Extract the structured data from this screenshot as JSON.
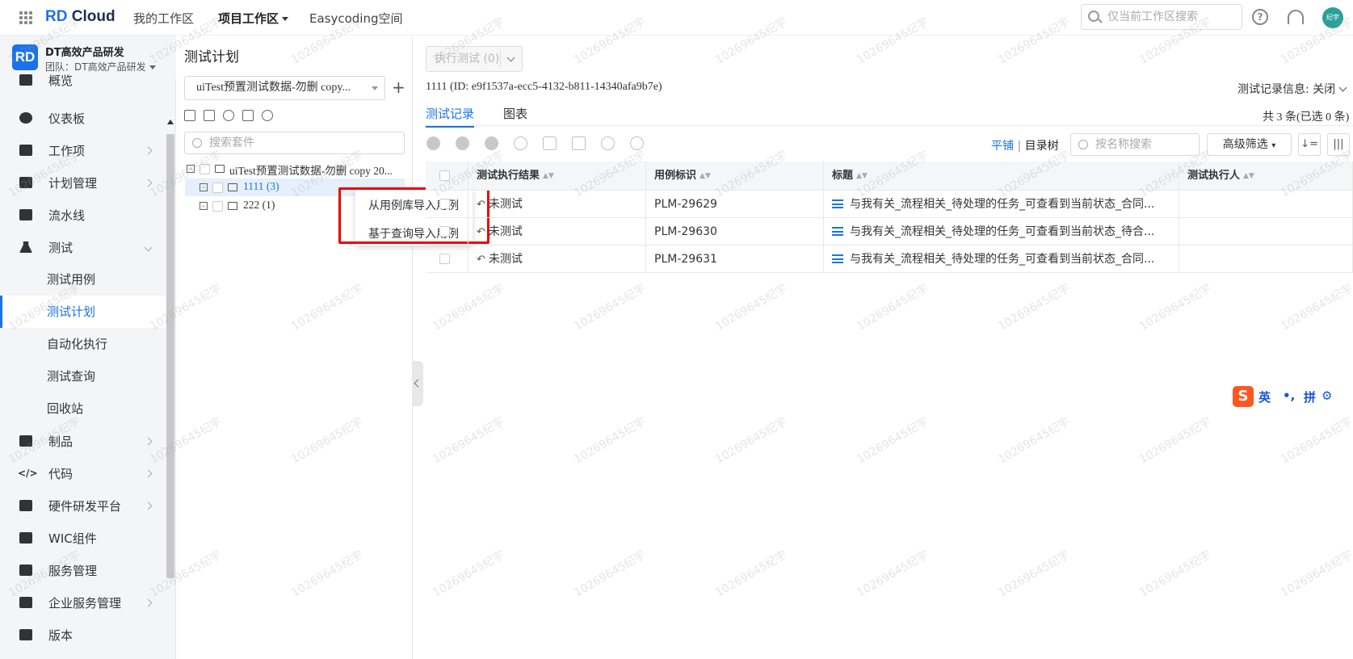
{
  "topbar": {
    "logo_rd": "RD",
    "logo_cloud": "Cloud",
    "nav": [
      "我的工作区",
      "项目工作区",
      "Easycoding空间"
    ],
    "search_placeholder": "仅当前工作区搜索",
    "avatar": "纪宇"
  },
  "sidebar": {
    "logo": "RD",
    "title": "DT高效产品研发",
    "team": "团队：DT高效产品研发",
    "items": [
      {
        "label": "概览",
        "icon": "overview-icon"
      },
      {
        "label": "仪表板",
        "icon": "dashboard-icon"
      },
      {
        "label": "工作项",
        "icon": "workitem-icon"
      },
      {
        "label": "计划管理",
        "icon": "plan-icon"
      },
      {
        "label": "流水线",
        "icon": "pipeline-icon"
      },
      {
        "label": "测试",
        "icon": "flask-icon"
      },
      {
        "label": "制品",
        "icon": "artifact-icon"
      },
      {
        "label": "代码",
        "icon": "code-icon"
      },
      {
        "label": "硬件研发平台",
        "icon": "hardware-icon"
      },
      {
        "label": "WIC组件",
        "icon": "wic-icon"
      },
      {
        "label": "服务管理",
        "icon": "service-icon"
      },
      {
        "label": "企业服务管理",
        "icon": "enterprise-icon"
      },
      {
        "label": "版本",
        "icon": "version-icon"
      }
    ],
    "sub": [
      "测试用例",
      "测试计划",
      "自动化执行",
      "测试查询",
      "回收站"
    ]
  },
  "mid": {
    "title": "测试计划",
    "plan_select": "uiTest预置测试数据-勿删 copy...",
    "search_placeholder": "搜索套件",
    "tree": {
      "root": "uiTest预置测试数据-勿删 copy 20...",
      "n1": "1111 (3)",
      "n2": "222 (1)"
    },
    "context_menu": [
      "从用例库导入用例",
      "基于查询导入用例"
    ]
  },
  "main": {
    "exec_btn": "执行测试 (0)",
    "plan_id": "1111 (ID: e9f1537a-ecc5-4132-b811-14340afa9b7e)",
    "record_info": "测试记录信息: 关闭",
    "tabs": [
      "测试记录",
      "图表"
    ],
    "count": "共 3 条(已选 0 条)",
    "view_flat": "平铺",
    "view_sep": "|",
    "view_tree": "目录树",
    "name_search": "按名称搜索",
    "adv_filter": "高级筛选",
    "columns": [
      "测试执行结果",
      "用例标识",
      "标题",
      "测试执行人"
    ],
    "rows": [
      {
        "result": "未测试",
        "id": "PLM-29629",
        "title": "与我有关_流程相关_待处理的任务_可查看到当前状态_合同...",
        "executor": ""
      },
      {
        "result": "未测试",
        "id": "PLM-29630",
        "title": "与我有关_流程相关_待处理的任务_可查看到当前状态_待合...",
        "executor": ""
      },
      {
        "result": "未测试",
        "id": "PLM-29631",
        "title": "与我有关_流程相关_待处理的任务_可查看到当前状态_合同...",
        "executor": ""
      }
    ]
  },
  "ime": {
    "logo": "S",
    "en": "英",
    "punct": "•,",
    "pin": "拼",
    "gear": "⚙"
  },
  "watermark": "10269645纪宇",
  "colors": {
    "accent": "#1a73e8",
    "highlight": "#e00000"
  }
}
